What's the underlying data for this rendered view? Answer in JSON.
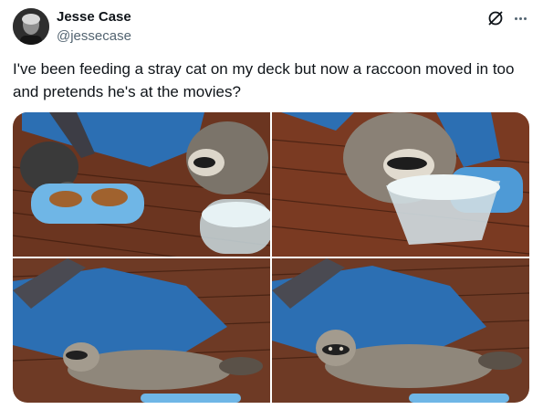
{
  "author": {
    "name": "Jesse Case",
    "handle": "@jessecase",
    "avatar_icon": "profile-photo"
  },
  "actions": {
    "grok_icon": "grok-icon",
    "more_icon": "more-options-icon"
  },
  "tweet": {
    "text": "I've been feeding a stray cat on my deck but now a raccoon moved in too and pretends he's at the movies?"
  },
  "media": {
    "photo_count": 4,
    "photos": [
      {
        "subject": "cat and raccoon eating from blue bowl"
      },
      {
        "subject": "raccoon drinking from water bowl"
      },
      {
        "subject": "raccoon lying on back near blue tarp"
      },
      {
        "subject": "raccoon lounging on back looking at camera"
      }
    ]
  },
  "colors": {
    "text_primary": "#0f1419",
    "text_secondary": "#536471",
    "deck_wood": "#7a3a22",
    "tarp_blue": "#2c6fb3"
  }
}
